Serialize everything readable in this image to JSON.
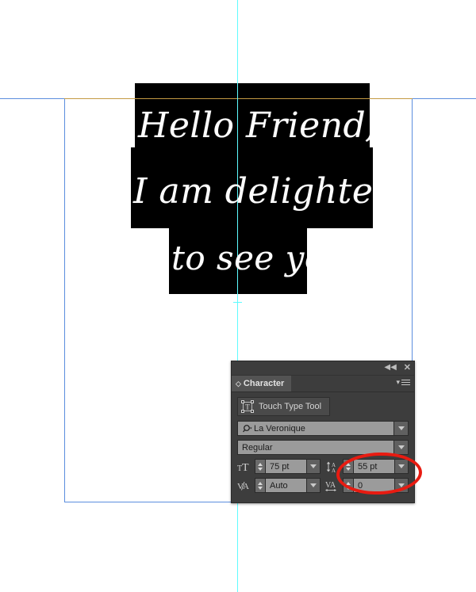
{
  "canvas": {
    "artwork_lines": [
      "Hello Friend;",
      "I am delighted",
      "to see you"
    ],
    "guide_color": "#5efbff",
    "artboard_border_color": "#5b8dde",
    "baseline_guide_color": "#c49a43",
    "highlight_block_color": "#000000",
    "text_color": "#ffffff"
  },
  "panel": {
    "titlebar": {
      "collapse_icon": "◀◀",
      "close_icon": "✕"
    },
    "tab_label": "Character",
    "tab_grip_glyph": "◇",
    "menu_icon": "panel-menu-icon",
    "touch_type_tool": {
      "label": "Touch Type Tool",
      "icon": "touch-type-tool-icon"
    },
    "font_family": {
      "icon": "search-icon",
      "value": "La Veronique"
    },
    "font_style": {
      "value": "Regular"
    },
    "font_size": {
      "icon": "font-size-icon",
      "icon_glyph": "TT",
      "value": "75 pt"
    },
    "leading": {
      "icon": "leading-icon",
      "value": "55 pt",
      "highlighted": true
    },
    "kerning": {
      "icon": "kerning-icon",
      "icon_glyph": "V/A",
      "value": "Auto"
    },
    "tracking": {
      "icon": "tracking-icon",
      "icon_glyph": "VA",
      "value": "0"
    }
  },
  "annotation": {
    "shape": "ellipse",
    "color": "#e81b11",
    "target": "leading-value-field"
  }
}
